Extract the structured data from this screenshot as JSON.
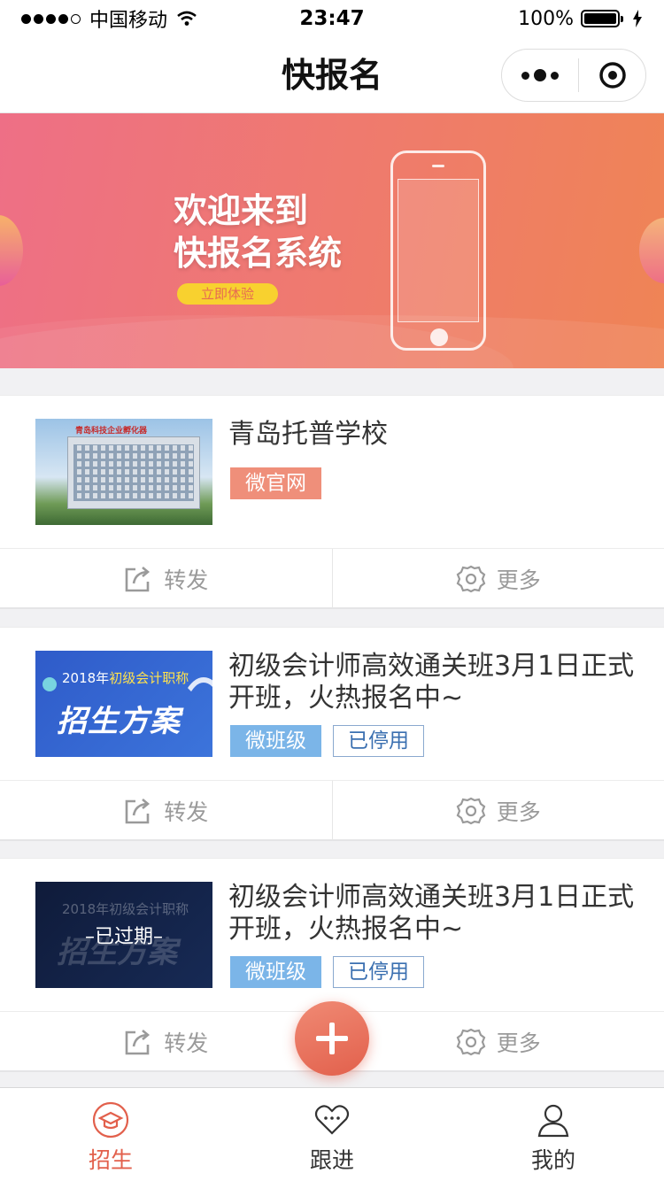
{
  "status_bar": {
    "carrier": "中国移动",
    "time": "23:47",
    "battery_percent": "100%",
    "battery_level": 1.0,
    "signal_bars_filled": 4,
    "signal_bars_total": 5
  },
  "nav": {
    "title": "快报名",
    "menu_icon": "more-dots-icon",
    "close_icon": "target-close-icon"
  },
  "banner": {
    "line1": "欢迎来到",
    "line2": "快报名系统",
    "cta_label": "立即体验"
  },
  "cards": [
    {
      "title": "青岛托普学校",
      "thumb_sign": "青岛科技企业孵化器",
      "tags": [
        {
          "label": "微官网",
          "style": "orange"
        }
      ],
      "actions": {
        "share": "转发",
        "more": "更多"
      }
    },
    {
      "title": "初级会计师高效通关班3月1日正式开班，火热报名中~",
      "thumb_year": "2018年",
      "thumb_year_hl": "初级会计职称",
      "thumb_big": "招生方案",
      "tags": [
        {
          "label": "微班级",
          "style": "blue"
        },
        {
          "label": "已停用",
          "style": "outline"
        }
      ],
      "actions": {
        "share": "转发",
        "more": "更多"
      }
    },
    {
      "title": "初级会计师高效通关班3月1日正式开班，火热报名中~",
      "thumb_year": "2018年初级会计职称",
      "thumb_big": "招生方案",
      "thumb_expired_label": "–已过期–",
      "tags": [
        {
          "label": "微班级",
          "style": "blue"
        },
        {
          "label": "已停用",
          "style": "outline"
        }
      ],
      "actions": {
        "share": "转发",
        "more": "更多"
      }
    }
  ],
  "fab": {
    "icon": "plus-icon"
  },
  "tab_bar": {
    "tabs": [
      {
        "label": "招生",
        "icon": "graduation-cap-icon",
        "active": true
      },
      {
        "label": "跟进",
        "icon": "heart-chat-icon",
        "active": false
      },
      {
        "label": "我的",
        "icon": "user-icon",
        "active": false
      }
    ]
  },
  "colors": {
    "accent": "#e2604c",
    "tag_orange": "#ef8f7a",
    "tag_blue": "#7bb5e8",
    "banner_start": "#ee6f86",
    "banner_end": "#ef8455"
  }
}
